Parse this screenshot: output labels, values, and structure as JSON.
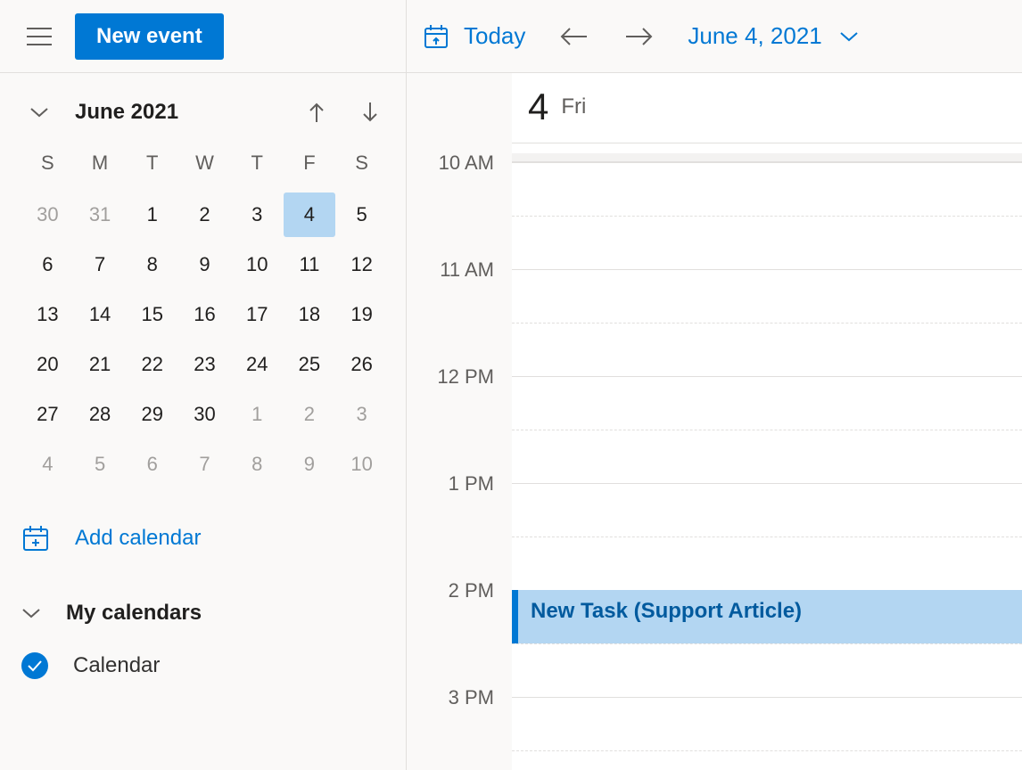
{
  "header": {
    "new_event_label": "New event",
    "today_label": "Today",
    "current_date_label": "June 4, 2021"
  },
  "mini_calendar": {
    "title": "June 2021",
    "dow": [
      "S",
      "M",
      "T",
      "W",
      "T",
      "F",
      "S"
    ],
    "weeks": [
      [
        {
          "n": "30",
          "o": true
        },
        {
          "n": "31",
          "o": true
        },
        {
          "n": "1"
        },
        {
          "n": "2"
        },
        {
          "n": "3"
        },
        {
          "n": "4",
          "sel": true
        },
        {
          "n": "5"
        }
      ],
      [
        {
          "n": "6"
        },
        {
          "n": "7"
        },
        {
          "n": "8"
        },
        {
          "n": "9"
        },
        {
          "n": "10"
        },
        {
          "n": "11"
        },
        {
          "n": "12"
        }
      ],
      [
        {
          "n": "13"
        },
        {
          "n": "14"
        },
        {
          "n": "15"
        },
        {
          "n": "16"
        },
        {
          "n": "17"
        },
        {
          "n": "18"
        },
        {
          "n": "19"
        }
      ],
      [
        {
          "n": "20"
        },
        {
          "n": "21"
        },
        {
          "n": "22"
        },
        {
          "n": "23"
        },
        {
          "n": "24"
        },
        {
          "n": "25"
        },
        {
          "n": "26"
        }
      ],
      [
        {
          "n": "27"
        },
        {
          "n": "28"
        },
        {
          "n": "29"
        },
        {
          "n": "30"
        },
        {
          "n": "1",
          "o": true
        },
        {
          "n": "2",
          "o": true
        },
        {
          "n": "3",
          "o": true
        }
      ],
      [
        {
          "n": "4",
          "o": true
        },
        {
          "n": "5",
          "o": true
        },
        {
          "n": "6",
          "o": true
        },
        {
          "n": "7",
          "o": true
        },
        {
          "n": "8",
          "o": true
        },
        {
          "n": "9",
          "o": true
        },
        {
          "n": "10",
          "o": true
        }
      ]
    ]
  },
  "sidebar": {
    "add_calendar_label": "Add calendar",
    "group_label": "My calendars",
    "calendar_entry": {
      "name": "Calendar",
      "checked": true
    }
  },
  "dayview": {
    "day_number": "4",
    "day_name": "Fri",
    "hours": [
      "10 AM",
      "11 AM",
      "12 PM",
      "1 PM",
      "2 PM",
      "3 PM"
    ],
    "events": [
      {
        "title": "New Task (Support Article)",
        "start_hour_index": 4,
        "duration_halfhours": 1
      }
    ]
  },
  "colors": {
    "accent": "#0078d4",
    "event_bg": "#b3d6f2"
  }
}
